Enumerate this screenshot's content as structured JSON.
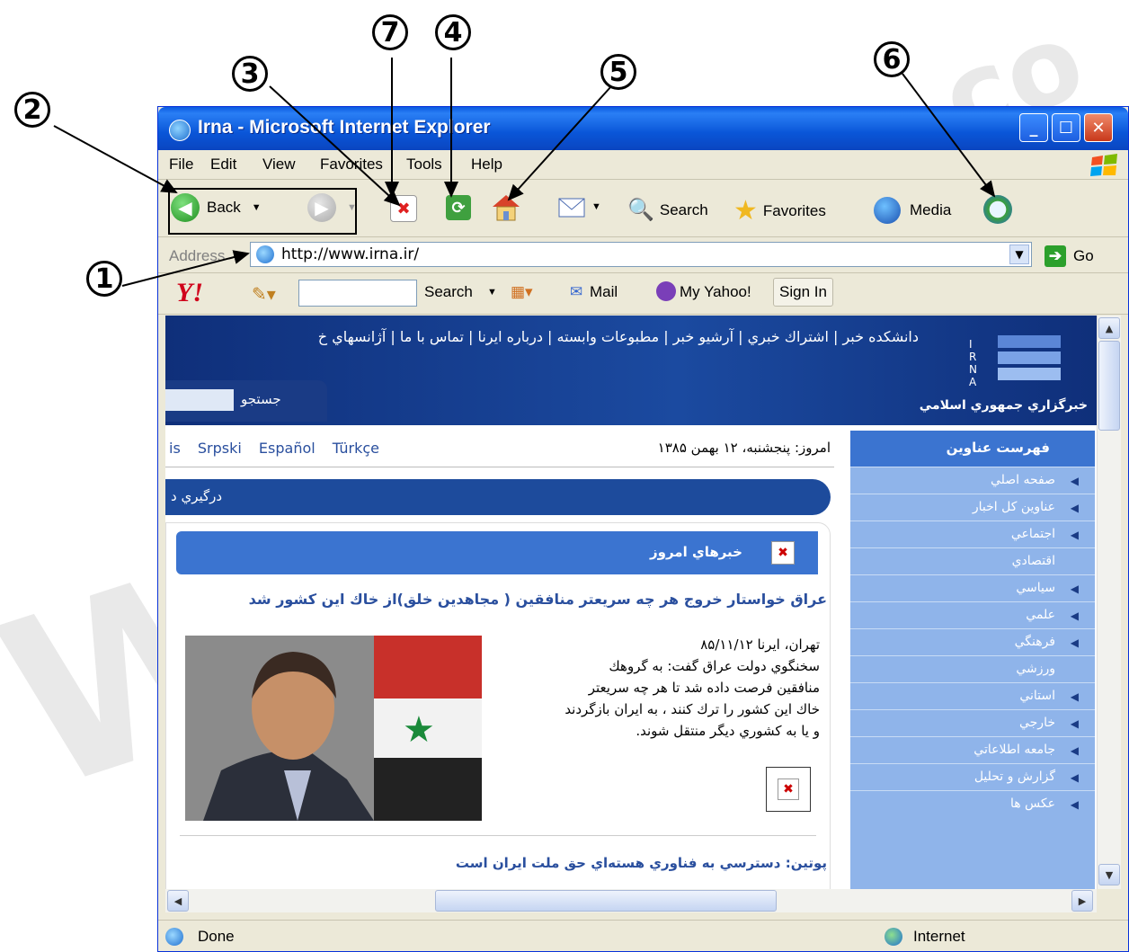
{
  "window": {
    "title": "Irna - Microsoft Internet Explorer",
    "controls": [
      "minimize-icon",
      "maximize-icon",
      "close-icon"
    ]
  },
  "menu": [
    "File",
    "Edit",
    "View",
    "Favorites",
    "Tools",
    "Help"
  ],
  "toolbar": {
    "back_label": "Back",
    "search_label": "Search",
    "favorites_label": "Favorites",
    "media_label": "Media"
  },
  "address": {
    "label": "Address",
    "url": "http://www.irna.ir/",
    "go_label": "Go"
  },
  "yahoo": {
    "logo": "Y!",
    "search_label": "Search",
    "mail_label": "Mail",
    "myyahoo_label": "My Yahoo!",
    "signin_label": "Sign In"
  },
  "callouts": [
    "1",
    "2",
    "3",
    "4",
    "5",
    "6",
    "7"
  ],
  "page": {
    "banner_links": "دانشکده خبر | اشتراك خبري | آرشيو خبر | مطبوعات وابسته | درباره ايرنا | تماس با ما | آژانسهاي خ",
    "irna_tagline": "خبرگزاري جمهوري اسلامي",
    "search_label": "جستجو",
    "languages": [
      "is",
      "Srpski",
      "Español",
      "Türkçe"
    ],
    "today": "امروز: پنجشنبه، ۱۲ بهمن ۱۳۸۵",
    "bluebar_text": "درگيري د",
    "news_header": "خبرهاي امروز",
    "headline": "عراق خواستار خروج هر چه سريعتر منافقين ( مجاهدين خلق)از خاك اين كشور شد",
    "article_lines": [
      "تهران، ايرنا ۸۵/۱۱/۱۲",
      "سخنگوي دولت عراق گفت: به گروهك",
      "منافقين فرصت داده شد تا هر چه سريعتر",
      "خاك اين كشور را ترك كنند ، به ايران بازگردند",
      "و يا به كشوري ديگر منتقل شوند."
    ],
    "headline2": "پوتين: دسترسي به فناوري هسته‌اي حق ملت ايران است",
    "sidebar_title": "فهرست عناوين",
    "sidebar_items": [
      {
        "label": "صفحه اصلي",
        "arrow": true
      },
      {
        "label": "عناوين كل اخبار",
        "arrow": true
      },
      {
        "label": "اجتماعي",
        "arrow": true
      },
      {
        "label": "اقتصادي",
        "arrow": false
      },
      {
        "label": "سياسي",
        "arrow": true
      },
      {
        "label": "علمي",
        "arrow": true
      },
      {
        "label": "فرهنگي",
        "arrow": true
      },
      {
        "label": "ورزشي",
        "arrow": false
      },
      {
        "label": "استاني",
        "arrow": true
      },
      {
        "label": "خارجي",
        "arrow": true
      },
      {
        "label": "جامعه اطلاعاتي",
        "arrow": true
      },
      {
        "label": "گزارش و تحليل",
        "arrow": true
      },
      {
        "label": "عكس ها",
        "arrow": true
      }
    ]
  },
  "status": {
    "text": "Done",
    "zone": "Internet"
  },
  "watermark": [
    "W",
    "co"
  ]
}
